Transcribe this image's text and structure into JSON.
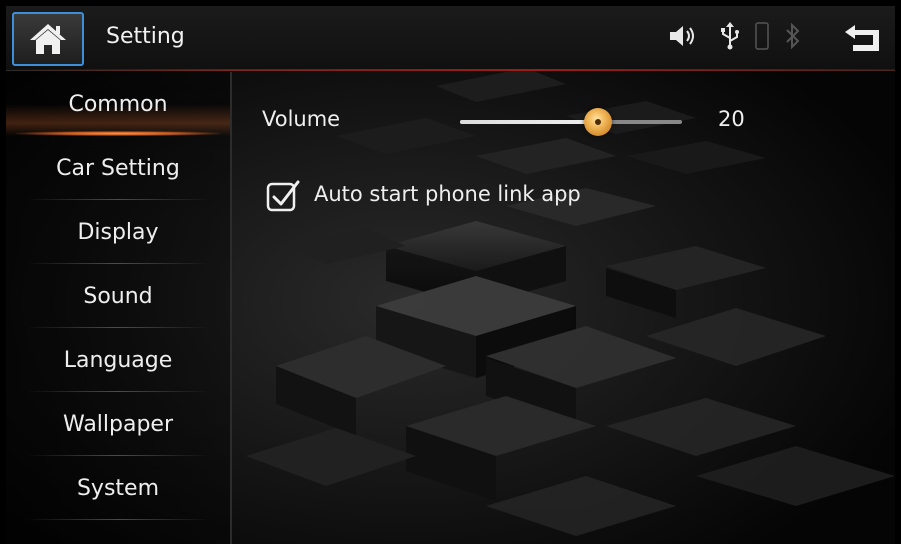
{
  "header": {
    "title": "Setting",
    "icons": [
      "home-icon",
      "speaker-icon",
      "usb-icon",
      "phone-icon",
      "bluetooth-icon",
      "back-icon"
    ]
  },
  "sidebar": {
    "items": [
      {
        "label": "Common",
        "active": true
      },
      {
        "label": "Car Setting",
        "active": false
      },
      {
        "label": "Display",
        "active": false
      },
      {
        "label": "Sound",
        "active": false
      },
      {
        "label": "Language",
        "active": false
      },
      {
        "label": "Wallpaper",
        "active": false
      },
      {
        "label": "System",
        "active": false
      }
    ]
  },
  "main": {
    "volume": {
      "label": "Volume",
      "value": "20",
      "fraction": 0.62
    },
    "auto_start": {
      "label": "Auto start phone link app",
      "checked": true
    }
  },
  "colors": {
    "accent_blue": "#3e8ed8",
    "active_glow": "#ff9a4a",
    "thumb": "#f2b85a",
    "divider_red": "#9b1e10"
  }
}
